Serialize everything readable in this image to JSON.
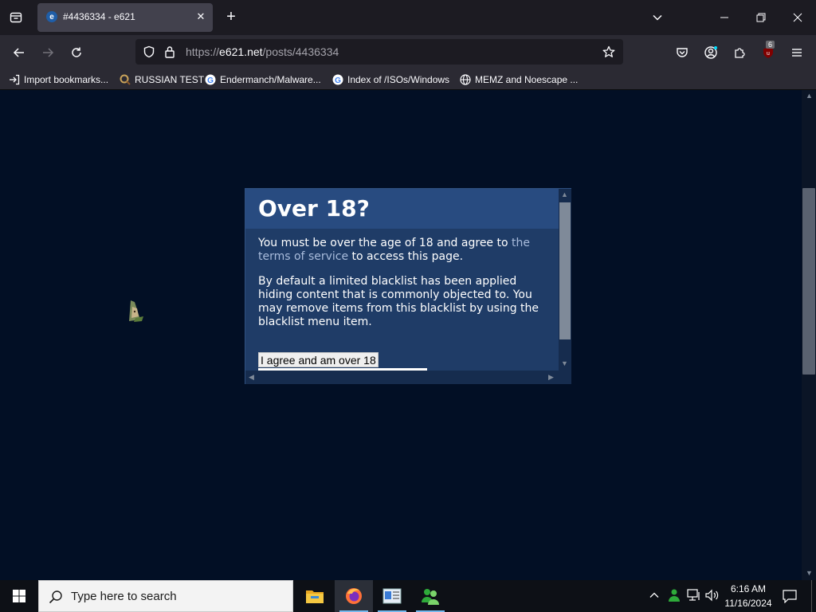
{
  "browser": {
    "tab": {
      "favicon_letter": "e",
      "title": "#4436334 - e621",
      "close_glyph": "✕"
    },
    "new_tab_glyph": "+",
    "url": {
      "scheme": "https://",
      "host": "e621.net",
      "path": "/posts/4436334"
    },
    "extension_badge": "6",
    "bookmarks": [
      {
        "label": "Import bookmarks...",
        "icon": "import-icon"
      },
      {
        "label": "RUSSIAN TEST",
        "icon": "magnifier-favicon"
      },
      {
        "label": "Endermanch/Malware...",
        "icon": "google-favicon"
      },
      {
        "label": "Index of /ISOs/Windows",
        "icon": "google-favicon"
      },
      {
        "label": "MEMZ and Noescape ...",
        "icon": "globe-icon"
      }
    ]
  },
  "dialog": {
    "title": "Over 18?",
    "para1_before": "You must be over the age of 18 and agree to ",
    "para1_link": "the terms of service",
    "para1_after": " to access this page.",
    "para2": "By default a limited blacklist has been applied hiding content that is commonly objected to. You may remove items from this blacklist by using the blacklist menu item.",
    "agree_label": "I agree and am over 18"
  },
  "taskbar": {
    "search_placeholder": "Type here to search",
    "apps": [
      "file-explorer-icon",
      "firefox-icon",
      "news-app-icon",
      "people-app-icon"
    ],
    "clock_time": "6:16 AM",
    "clock_date": "11/16/2024"
  },
  "colors": {
    "page_bg": "#020f25",
    "dialog_bg": "#1f3c67",
    "dialog_header": "#284b80",
    "link": "#a9bcdc"
  }
}
